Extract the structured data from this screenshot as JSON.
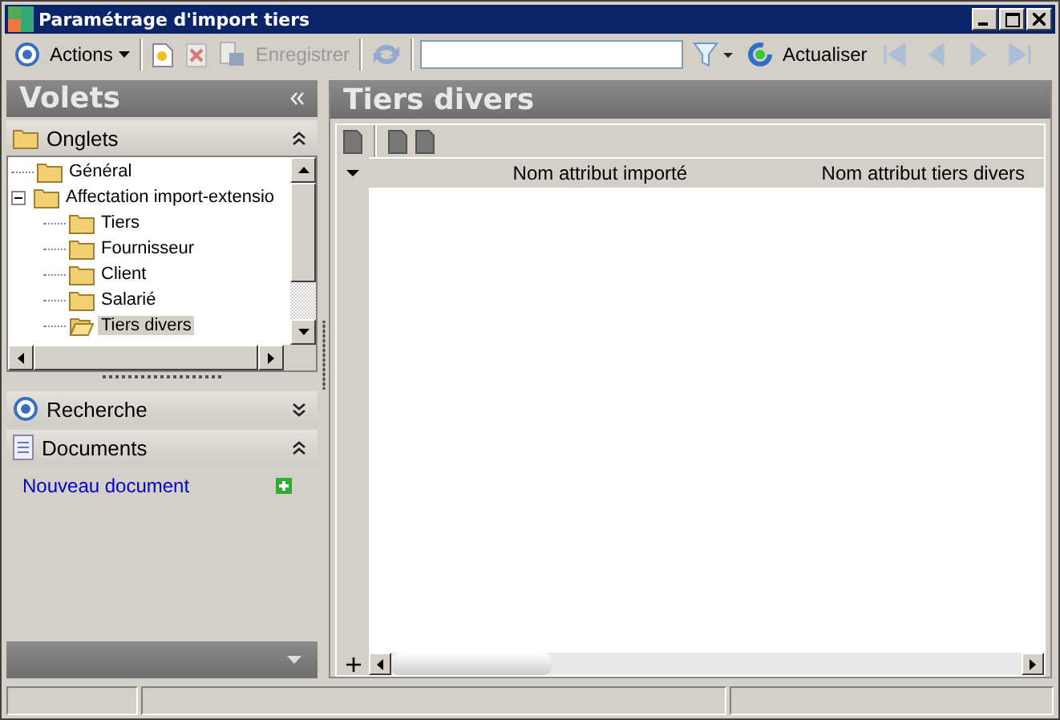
{
  "window": {
    "title": "Paramétrage d'import tiers"
  },
  "toolbar": [
    {
      "kind": "target",
      "label": "Actions",
      "disabled": false
    },
    {
      "kind": "new",
      "disabled": false
    },
    {
      "kind": "delete",
      "disabled": true
    },
    {
      "kind": "save",
      "label": "Enregistrer",
      "disabled": true
    },
    {
      "kind": "sync",
      "disabled": true
    },
    {
      "kind": "search"
    },
    {
      "kind": "filter",
      "disabled": false
    },
    {
      "kind": "refresh",
      "label": "Actualiser",
      "disabled": false
    },
    {
      "kind": "first",
      "disabled": true
    },
    {
      "kind": "prev",
      "disabled": true
    },
    {
      "kind": "next",
      "disabled": true
    },
    {
      "kind": "last",
      "disabled": true
    }
  ],
  "sidebar": {
    "title": "Volets",
    "sections": [
      {
        "kind": "tabs",
        "label": "Onglets",
        "expanded": true
      },
      {
        "kind": "search",
        "label": "Recherche",
        "expanded": false
      },
      {
        "kind": "documents",
        "label": "Documents",
        "expanded": true,
        "link": "Nouveau document"
      }
    ],
    "tree": [
      {
        "label": "Général",
        "selected": false
      },
      {
        "label": "Affectation import-extensio",
        "selected": false,
        "expanded": true,
        "children": [
          {
            "label": "Tiers",
            "selected": false
          },
          {
            "label": "Fournisseur",
            "selected": false
          },
          {
            "label": "Client",
            "selected": false
          },
          {
            "label": "Salarié",
            "selected": false
          },
          {
            "label": "Tiers divers",
            "selected": true
          }
        ]
      }
    ]
  },
  "main": {
    "title": "Tiers divers",
    "table": {
      "columns": [
        "Nom attribut importé",
        "Nom attribut tiers divers"
      ]
    }
  }
}
